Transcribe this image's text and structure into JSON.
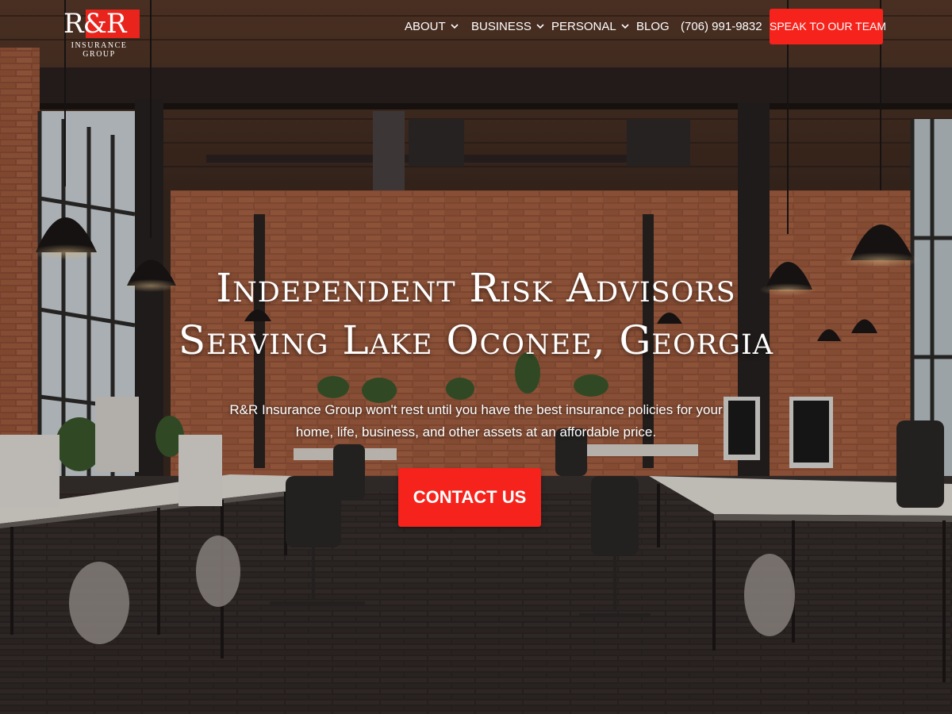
{
  "brand": {
    "logo_mark": "R&R",
    "logo_subtitle": "INSURANCE GROUP",
    "accent_color": "#f6231c",
    "logo_red": "#e8241c"
  },
  "nav": {
    "items": [
      {
        "label": "ABOUT",
        "has_dropdown": true,
        "icon": "chevron-down-icon"
      },
      {
        "label": "BUSINESS",
        "has_dropdown": true,
        "icon": "chevron-down-icon"
      },
      {
        "label": "PERSONAL",
        "has_dropdown": true,
        "icon": "chevron-down-icon"
      },
      {
        "label": "BLOG",
        "has_dropdown": false
      },
      {
        "label": "(706) 991-9832",
        "has_dropdown": false
      }
    ],
    "cta_label": "SPEAK TO OUR TEAM"
  },
  "hero": {
    "title_line1": "Independent Risk Advisors",
    "title_line2": "Serving Lake Oconee, Georgia",
    "subtitle_line1": "R&R Insurance Group won't rest until you have the best insurance policies for your",
    "subtitle_line2": "home, life, business, and other assets at an affordable price.",
    "cta_label": "CONTACT US"
  }
}
